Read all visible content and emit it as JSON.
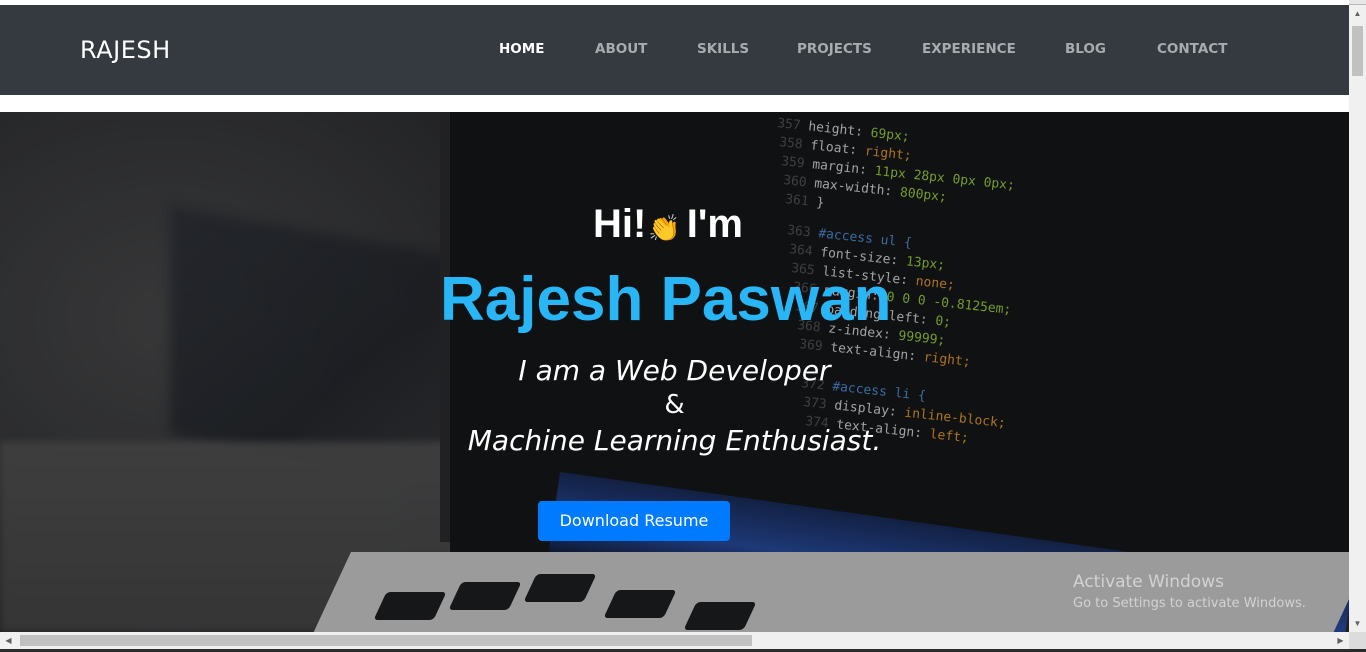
{
  "navbar": {
    "brand": "RAJESH",
    "links": [
      {
        "label": "HOME",
        "active": true
      },
      {
        "label": "ABOUT",
        "active": false
      },
      {
        "label": "SKILLS",
        "active": false
      },
      {
        "label": "PROJECTS",
        "active": false
      },
      {
        "label": "EXPERIENCE",
        "active": false
      },
      {
        "label": "BLOG",
        "active": false
      },
      {
        "label": "CONTACT",
        "active": false
      }
    ]
  },
  "hero": {
    "greeting_hi": "Hi!",
    "wave_emoji": "👏",
    "greeting_im": "I'm",
    "name": "Rajesh Paswan",
    "role_line1": "I am a Web Developer",
    "role_amp": "&",
    "role_line2": "Machine Learning Enthusiast.",
    "download_label": "Download Resume",
    "background_code": [
      {
        "no": "357",
        "text": "height: 69px;"
      },
      {
        "no": "358",
        "text": "float: right;"
      },
      {
        "no": "359",
        "text": "margin: 11px 28px 0px 0px;"
      },
      {
        "no": "360",
        "text": "max-width: 800px;"
      },
      {
        "no": "361",
        "text": "}"
      },
      {
        "no": "363",
        "text": "#access ul {"
      },
      {
        "no": "364",
        "text": "font-size: 13px;"
      },
      {
        "no": "365",
        "text": "list-style: none;"
      },
      {
        "no": "366",
        "text": "margin: 0 0 0 -0.8125em;"
      },
      {
        "no": "367",
        "text": "padding-left: 0;"
      },
      {
        "no": "368",
        "text": "z-index: 99999;"
      },
      {
        "no": "369",
        "text": "text-align: right;"
      },
      {
        "no": "372",
        "text": "#access li {"
      },
      {
        "no": "373",
        "text": "display: inline-block;"
      },
      {
        "no": "374",
        "text": "text-align: left;"
      }
    ]
  },
  "watermark": {
    "title": "Activate Windows",
    "subtitle": "Go to Settings to activate Windows."
  },
  "colors": {
    "navbar_bg": "#343a40",
    "accent_name": "#29b6f6",
    "button_bg": "#007bff"
  }
}
